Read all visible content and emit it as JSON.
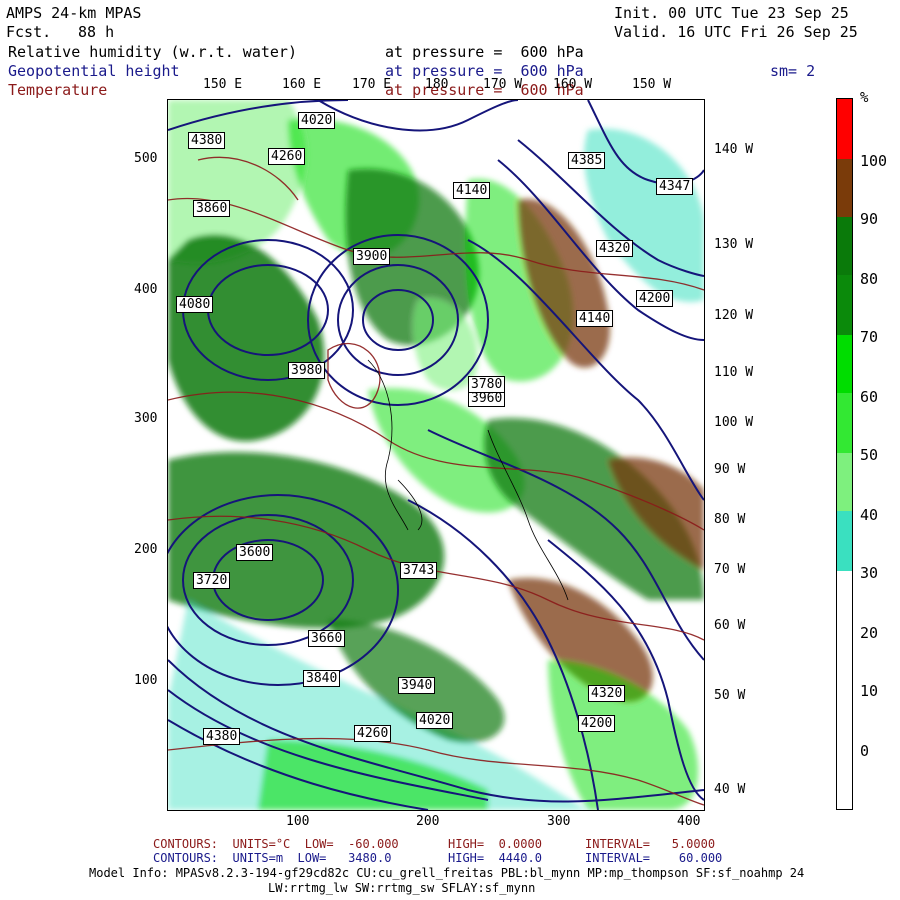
{
  "header": {
    "model": "AMPS 24-km MPAS",
    "fcst_label": "Fcst.",
    "fcst_value": "88 h",
    "init": "Init. 00 UTC Tue 23 Sep 25",
    "valid": "Valid. 16 UTC Fri 26 Sep 25",
    "field1": "Relative humidity (w.r.t. water)",
    "field1_level": "at pressure =  600 hPa",
    "field2": "Geopotential height",
    "field2_level": "at pressure =  600 hPa",
    "field3": "Temperature",
    "field3_level": "at pressure =  600 hPa",
    "smoothing": "sm= 2"
  },
  "lon_top": [
    "150 E",
    "160 E",
    "170 E",
    "180",
    "170 W",
    "160 W",
    "150 W"
  ],
  "lon_right": [
    "140 W",
    "130 W",
    "120 W",
    "110 W",
    "100 W",
    "90 W",
    "80 W",
    "70 W",
    "60 W",
    "50 W",
    "40 W"
  ],
  "y_ticks": [
    "500",
    "400",
    "300",
    "200",
    "100"
  ],
  "x_ticks": [
    "100",
    "200",
    "300",
    "400"
  ],
  "colorbar": {
    "unit": "%",
    "labels": [
      "100",
      "90",
      "80",
      "70",
      "60",
      "50",
      "40",
      "30",
      "20",
      "10",
      "0"
    ],
    "colors": {
      "c100": "#ff0000",
      "c90": "#7a3b0a",
      "c80": "#0a7a0a",
      "c70": "#0b8a0b",
      "c60": "#00dd00",
      "c50": "#33e833",
      "c40": "#7ef07e",
      "c30": "#3ae0c0",
      "c0": "#ffffff"
    }
  },
  "height_labels": [
    "4380",
    "4020",
    "4260",
    "3860",
    "4140",
    "4080",
    "3900",
    "3960",
    "3980",
    "4385",
    "4347",
    "4320",
    "4200",
    "4140",
    "3720",
    "3660",
    "3600",
    "3780",
    "3743",
    "3840",
    "3940",
    "4380",
    "4260",
    "4320",
    "4200",
    "4020"
  ],
  "footer": {
    "line1_a": "CONTOURS:  UNITS=°C  LOW=  -60.000",
    "line1_b": "HIGH=  0.0000",
    "line1_c": "INTERVAL=   5.0000",
    "line2_a": "CONTOURS:  UNITS=m  LOW=   3480.0",
    "line2_b": "HIGH=  4440.0",
    "line2_c": "INTERVAL=    60.000",
    "line3": "Model Info: MPASv8.2.3-194-gf29cd82c CU:cu_grell_freitas PBL:bl_mynn MP:mp_thompson SF:sf_noahmp 24",
    "line4": "LW:rrtmg_lw SW:rrtmg_sw SFLAY:sf_mynn"
  }
}
